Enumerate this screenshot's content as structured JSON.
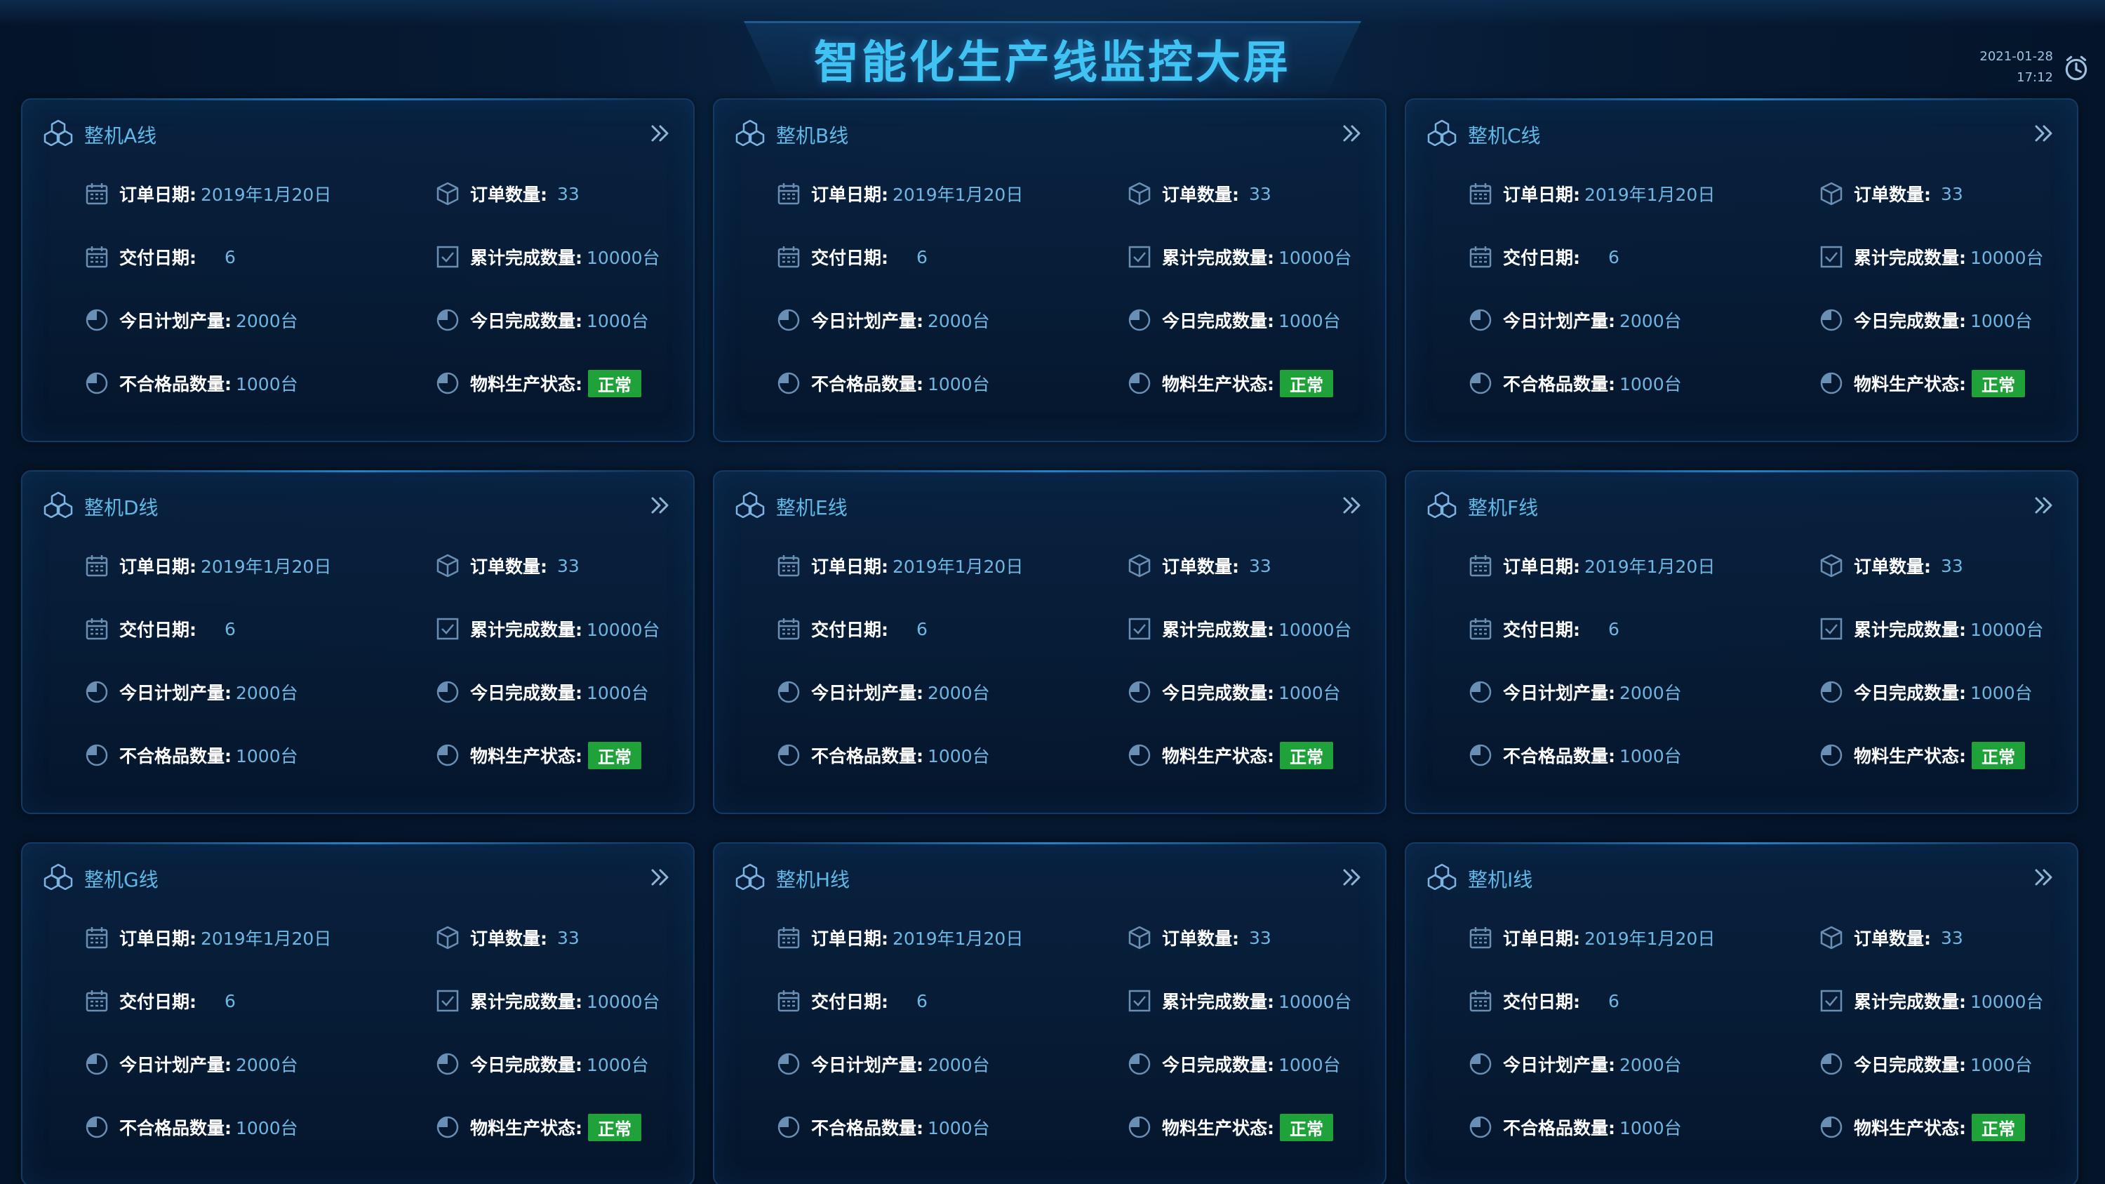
{
  "header": {
    "title": "智能化生产线监控大屏",
    "date": "2021-01-28",
    "time": "17:12"
  },
  "labels": {
    "order_date": "订单日期:",
    "order_qty": "订单数量:",
    "delivery_date": "交付日期:",
    "total_done": "累计完成数量:",
    "plan_today": "今日计划产量:",
    "done_today": "今日完成数量:",
    "defect_qty": "不合格品数量:",
    "material_status": "物料生产状态:"
  },
  "colors": {
    "title": "#3fc3f3",
    "value": "#6fb6e2",
    "status_ok": "#1fa23a",
    "icon": "#6a8fb4"
  },
  "lines": [
    {
      "name": "整机A线",
      "order_date": "2019年1月20日",
      "order_qty": "33",
      "delivery_date": "6",
      "total_done": "10000台",
      "plan_today": "2000台",
      "done_today": "1000台",
      "defect_qty": "1000台",
      "material_status": "正常"
    },
    {
      "name": "整机B线",
      "order_date": "2019年1月20日",
      "order_qty": "33",
      "delivery_date": "6",
      "total_done": "10000台",
      "plan_today": "2000台",
      "done_today": "1000台",
      "defect_qty": "1000台",
      "material_status": "正常"
    },
    {
      "name": "整机C线",
      "order_date": "2019年1月20日",
      "order_qty": "33",
      "delivery_date": "6",
      "total_done": "10000台",
      "plan_today": "2000台",
      "done_today": "1000台",
      "defect_qty": "1000台",
      "material_status": "正常"
    },
    {
      "name": "整机D线",
      "order_date": "2019年1月20日",
      "order_qty": "33",
      "delivery_date": "6",
      "total_done": "10000台",
      "plan_today": "2000台",
      "done_today": "1000台",
      "defect_qty": "1000台",
      "material_status": "正常"
    },
    {
      "name": "整机E线",
      "order_date": "2019年1月20日",
      "order_qty": "33",
      "delivery_date": "6",
      "total_done": "10000台",
      "plan_today": "2000台",
      "done_today": "1000台",
      "defect_qty": "1000台",
      "material_status": "正常"
    },
    {
      "name": "整机F线",
      "order_date": "2019年1月20日",
      "order_qty": "33",
      "delivery_date": "6",
      "total_done": "10000台",
      "plan_today": "2000台",
      "done_today": "1000台",
      "defect_qty": "1000台",
      "material_status": "正常"
    },
    {
      "name": "整机G线",
      "order_date": "2019年1月20日",
      "order_qty": "33",
      "delivery_date": "6",
      "total_done": "10000台",
      "plan_today": "2000台",
      "done_today": "1000台",
      "defect_qty": "1000台",
      "material_status": "正常"
    },
    {
      "name": "整机H线",
      "order_date": "2019年1月20日",
      "order_qty": "33",
      "delivery_date": "6",
      "total_done": "10000台",
      "plan_today": "2000台",
      "done_today": "1000台",
      "defect_qty": "1000台",
      "material_status": "正常"
    },
    {
      "name": "整机I线",
      "order_date": "2019年1月20日",
      "order_qty": "33",
      "delivery_date": "6",
      "total_done": "10000台",
      "plan_today": "2000台",
      "done_today": "1000台",
      "defect_qty": "1000台",
      "material_status": "正常"
    }
  ]
}
